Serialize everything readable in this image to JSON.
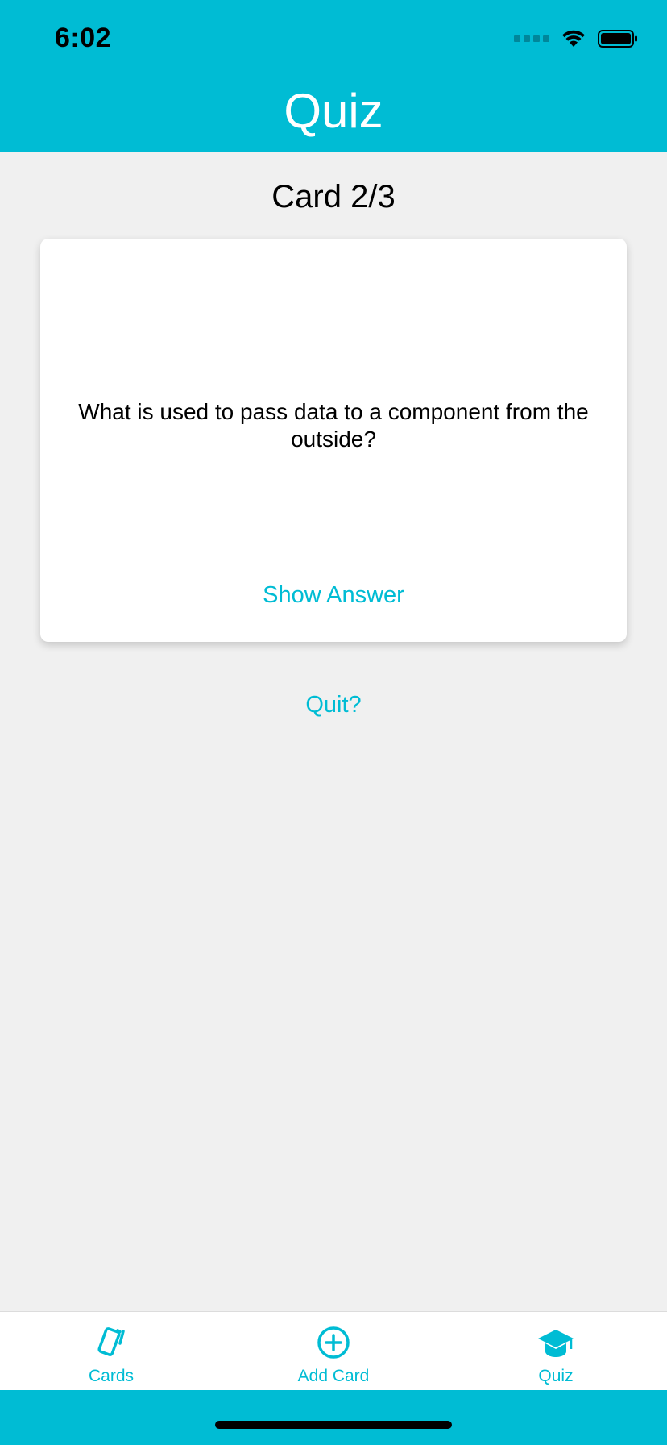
{
  "status_bar": {
    "time": "6:02"
  },
  "header": {
    "title": "Quiz"
  },
  "quiz": {
    "counter": "Card 2/3",
    "question": "What is used to pass data to a component from the outside?",
    "show_answer_label": "Show Answer",
    "quit_label": "Quit?"
  },
  "tabbar": {
    "items": [
      {
        "label": "Cards",
        "icon": "cards-icon"
      },
      {
        "label": "Add Card",
        "icon": "add-circle-icon"
      },
      {
        "label": "Quiz",
        "icon": "graduation-cap-icon"
      }
    ]
  },
  "colors": {
    "accent": "#00bcd4",
    "background": "#f0f0f0",
    "card": "#ffffff"
  }
}
